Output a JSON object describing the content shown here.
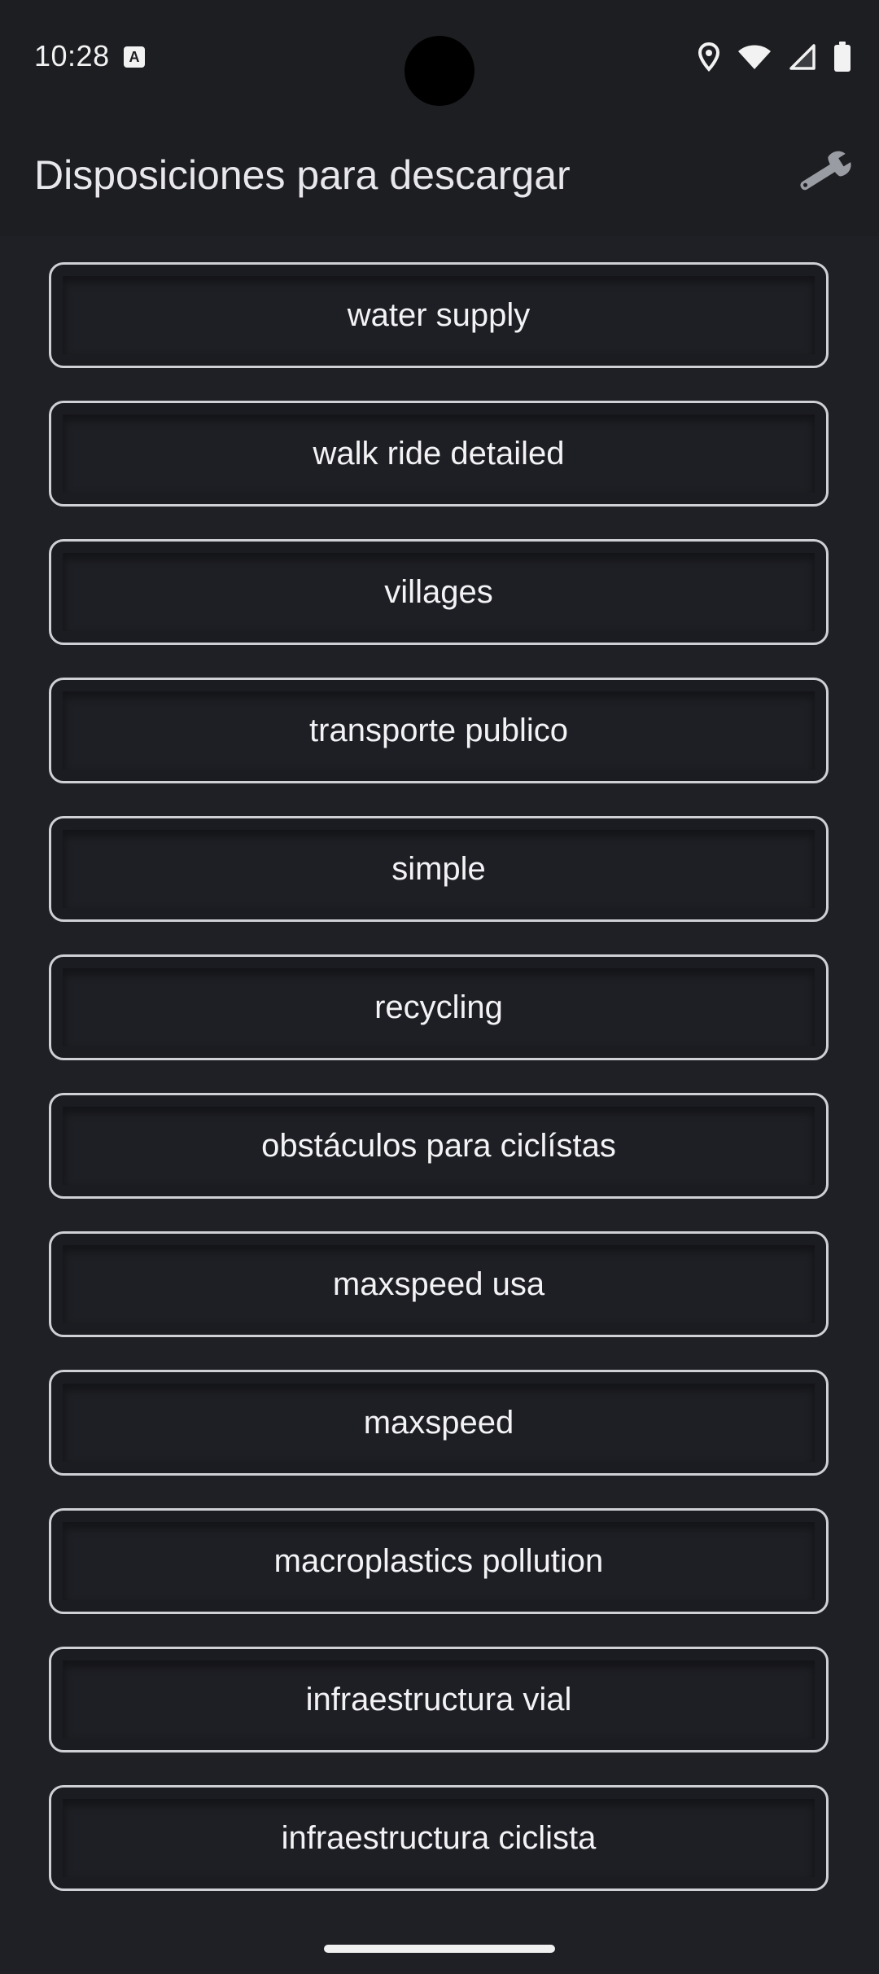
{
  "status_bar": {
    "time": "10:28",
    "notification_glyph": "A",
    "icons": [
      "location-icon",
      "wifi-icon",
      "cell-signal-icon",
      "battery-icon"
    ]
  },
  "app_bar": {
    "title": "Disposiciones para descargar",
    "settings_icon": "wrench-icon"
  },
  "layouts": [
    {
      "label": "water supply"
    },
    {
      "label": "walk ride detailed"
    },
    {
      "label": "villages"
    },
    {
      "label": "transporte publico"
    },
    {
      "label": "simple"
    },
    {
      "label": "recycling"
    },
    {
      "label": "obstáculos para ciclístas"
    },
    {
      "label": "maxspeed usa"
    },
    {
      "label": "maxspeed"
    },
    {
      "label": "macroplastics pollution"
    },
    {
      "label": "infraestructura vial"
    },
    {
      "label": "infraestructura ciclista"
    }
  ],
  "colors": {
    "background": "#1f2026",
    "bar": "#1d1e22",
    "button_border": "#cfd0d6",
    "text": "#f3f3f6"
  }
}
